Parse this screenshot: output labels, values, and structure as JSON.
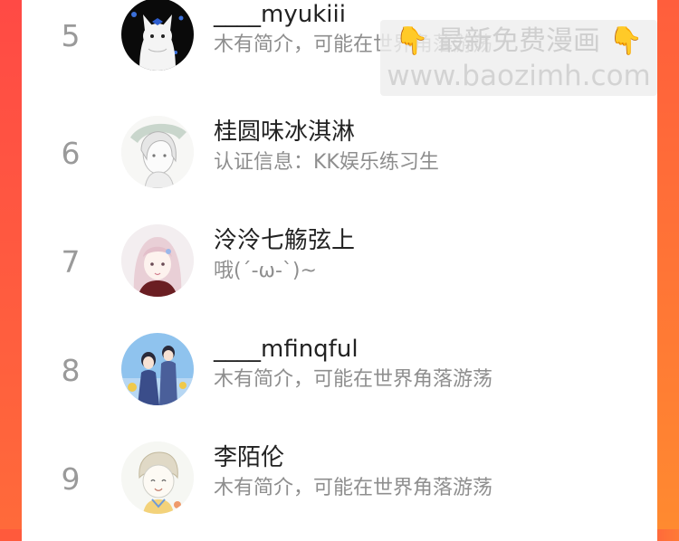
{
  "users": [
    {
      "rank": "5",
      "name": "____myukiii",
      "bio": "木有简介，可能在世界角落游荡",
      "avatar": "avatar-white-cat-blue-butterfly"
    },
    {
      "rank": "6",
      "name": "桂圆味冰淇淋",
      "bio": "认证信息：KK娱乐练习生",
      "avatar": "avatar-sketch-girl"
    },
    {
      "rank": "7",
      "name": "泠泠七觞弦上",
      "bio": "哦(´-ω-`)~",
      "avatar": "avatar-pink-hair-girl"
    },
    {
      "rank": "8",
      "name": "____mfinqful",
      "bio": "木有简介，可能在世界角落游荡",
      "avatar": "avatar-couple-illustration"
    },
    {
      "rank": "9",
      "name": "李陌伦",
      "bio": "木有简介，可能在世界角落游荡",
      "avatar": "avatar-boy-sketch"
    }
  ],
  "watermark": {
    "line1": "最新免费漫画",
    "hand_icon": "👇",
    "line2": "www.baozimh.com"
  },
  "colors": {
    "accent_left": "#ff4a45",
    "accent_right": "#ff8a30",
    "rank_gray": "#9a9a9a",
    "bio_gray": "#8e8e8e"
  }
}
